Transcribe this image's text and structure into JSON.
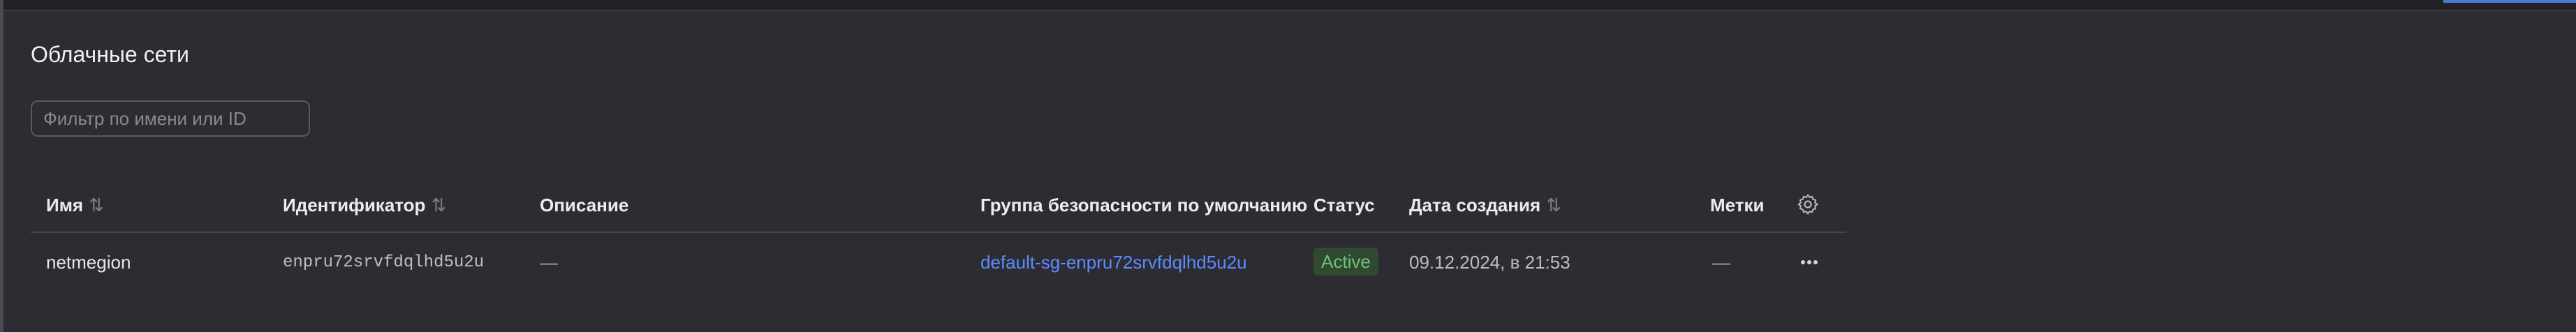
{
  "page": {
    "title": "Облачные сети"
  },
  "filter": {
    "placeholder": "Фильтр по имени или ID",
    "value": ""
  },
  "table": {
    "columns": {
      "name": "Имя",
      "id": "Идентификатор",
      "description": "Описание",
      "security_group": "Группа безопасности по умолчанию",
      "status": "Статус",
      "created": "Дата создания",
      "labels": "Метки"
    },
    "rows": [
      {
        "name": "netmegion",
        "id": "enpru72srvfdqlhd5u2u",
        "description": "—",
        "security_group": "default-sg-enpru72srvfdqlhd5u2u",
        "status": "Active",
        "created": "09.12.2024, в 21:53",
        "labels": "—"
      }
    ]
  },
  "icons": {
    "sort": "sort-arrows-icon",
    "settings": "gear-icon",
    "row_actions": "more-horizontal-icon"
  },
  "colors": {
    "background": "#2d2c33",
    "link": "#5b8cff",
    "status_active_bg": "#2f4a31",
    "status_active_text": "#6ec17a",
    "accent": "#4a7bd0"
  }
}
